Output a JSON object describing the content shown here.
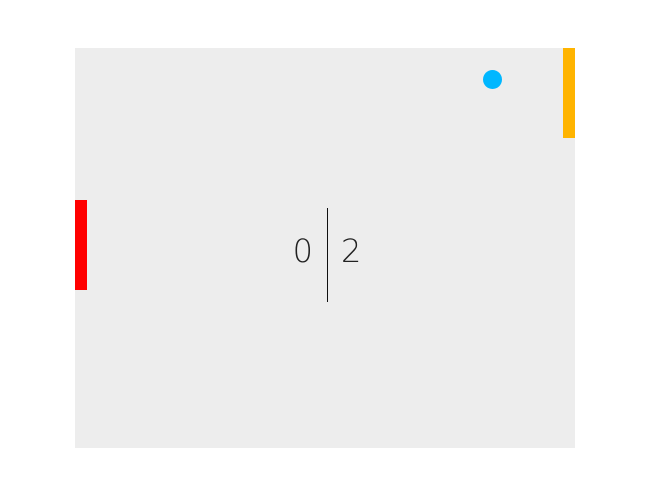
{
  "game": {
    "type": "pong",
    "colors": {
      "court": "#ededed",
      "left_paddle": "#ff0000",
      "right_paddle": "#ffb400",
      "ball": "#00b7ff",
      "divider": "#111111"
    },
    "score": {
      "left": "0",
      "right": "2"
    }
  }
}
